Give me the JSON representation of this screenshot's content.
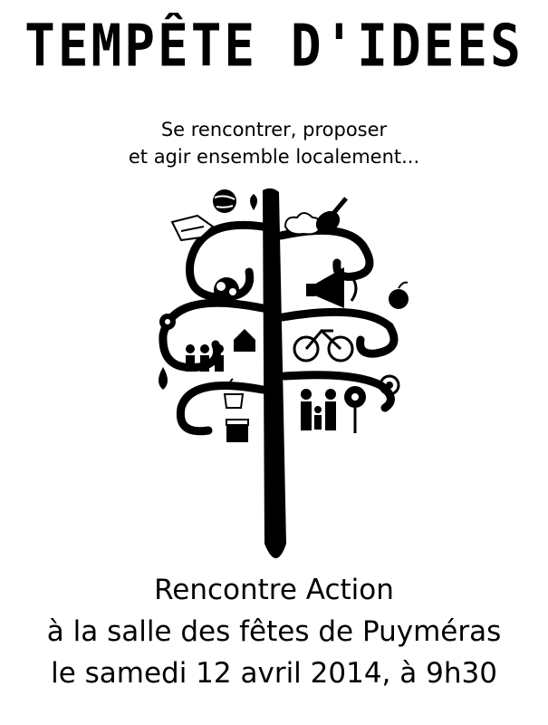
{
  "poster": {
    "title": "TEMPÊTE D'IDEES",
    "tagline": [
      "Se rencontrer, proposer",
      "et agir ensemble localement..."
    ],
    "event": {
      "heading": "Rencontre Action",
      "location": "à la salle des fêtes de Puyméras",
      "date": "le samedi 12 avril 2014, à 9h30"
    },
    "illustration": {
      "type": "tree of ideas",
      "icons": [
        "globe-icon",
        "leaf-icon",
        "handshake-icon",
        "cloud-icon",
        "guitar-icon",
        "spiral-icon",
        "flower-icon",
        "water-drop-icon",
        "fruit-basket-icon",
        "megaphone-icon",
        "apple-icon",
        "bicycle-icon",
        "people-icon",
        "house-icon",
        "family-icon",
        "coffee-cup-icon",
        "film-clapper-icon",
        "recycle-icon"
      ]
    }
  }
}
